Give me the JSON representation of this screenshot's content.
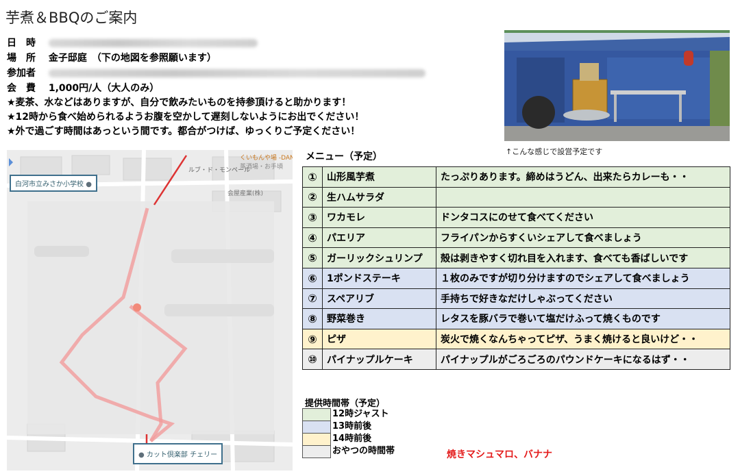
{
  "title": "芋煮＆BBQのご案内",
  "info": {
    "date_label": "日　時",
    "place_label": "場　所",
    "place_value": "金子邸庭　（下の地図を参照願います）",
    "participants_label": "参加者",
    "fee_label": "会　費",
    "fee_value": "1,000円/人（大人のみ）"
  },
  "notes": [
    "★麦茶、水などはありますが、自分で飲みたいものを持参頂けると助かります！",
    "★12時から食べ始められるようお腹を空かして遅刻しないようにお出でください！",
    "★外で過ごす時間はあっという間です。都合がつけば、ゆっくりご予定ください！"
  ],
  "photo_caption": "↑こんな感じで設営予定です",
  "map": {
    "school_label": "白河市立みさか小学校",
    "shop_label": "カット倶楽部 チェリー",
    "store_label": "くいもんや場 -DAN-",
    "store_sub": "蒸酒場・お手頃",
    "store2_label": "ルブ・ド・モンペール",
    "company_label": "会屋産業(株)"
  },
  "menu_title": "メニュー（予定）",
  "menu": [
    {
      "num": "①",
      "name": "山形風芋煮",
      "desc": "たっぷりあります。締めはうどん、出来たらカレーも・・",
      "color": "#e2efda"
    },
    {
      "num": "②",
      "name": "生ハムサラダ",
      "desc": "",
      "color": "#e2efda"
    },
    {
      "num": "③",
      "name": "ワカモレ",
      "desc": "ドンタコスにのせて食べてください",
      "color": "#e2efda"
    },
    {
      "num": "④",
      "name": "パエリア",
      "desc": "フライパンからすくいシェアして食べましょう",
      "color": "#e2efda"
    },
    {
      "num": "⑤",
      "name": "ガーリックシュリンプ",
      "desc": "殻は剥きやすく切れ目を入れます、食べても香ばしいです",
      "color": "#e2efda"
    },
    {
      "num": "⑥",
      "name": "1ポンドステーキ",
      "desc": "１枚のみですが切り分けますのでシェアして食べましょう",
      "color": "#d9e1f2"
    },
    {
      "num": "⑦",
      "name": "スペアリブ",
      "desc": "手持ちで好きなだけしゃぶってください",
      "color": "#d9e1f2"
    },
    {
      "num": "⑧",
      "name": "野菜巻き",
      "desc": "レタスを豚バラで巻いて塩だけふって焼くものです",
      "color": "#d9e1f2"
    },
    {
      "num": "⑨",
      "name": "ピザ",
      "desc": "炭火で焼くなんちゃってピザ、うまく焼けると良いけど・・",
      "color": "#fff2cc"
    },
    {
      "num": "⑩",
      "name": "パイナップルケーキ",
      "desc": "パイナップルがごろごろのパウンドケーキになるはず・・",
      "color": "#ededed"
    }
  ],
  "legend_title": "提供時間帯（予定）",
  "legend": [
    {
      "label": "12時ジャスト",
      "color": "#e2efda"
    },
    {
      "label": "13時前後",
      "color": "#d9e1f2"
    },
    {
      "label": "14時前後",
      "color": "#fff2cc"
    },
    {
      "label": "おやつの時間帯",
      "color": "#ededed"
    }
  ],
  "snack_note": "焼きマシュマロ、バナナ",
  "snack_color": "#e41b1b"
}
